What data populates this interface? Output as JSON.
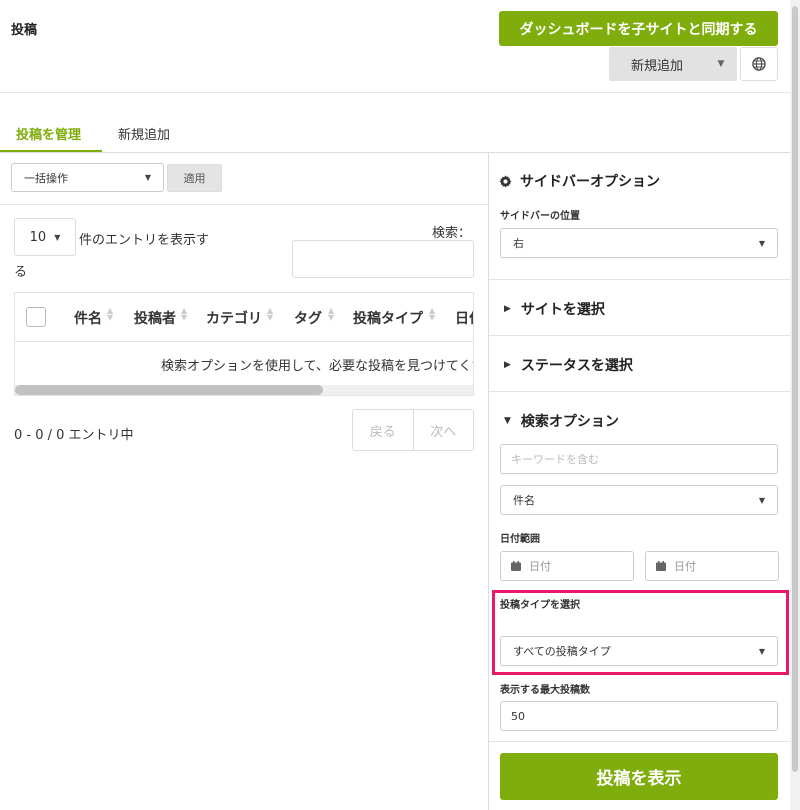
{
  "header": {
    "title": "投稿",
    "sync_button": "ダッシュボードを子サイトと同期する",
    "new_add_button": "新規追加"
  },
  "tabs": {
    "manage": "投稿を管理",
    "add_new": "新規追加"
  },
  "bulk": {
    "select_value": "一括操作",
    "apply_button": "適用"
  },
  "table_controls": {
    "length_value": "10",
    "length_text_1": "件のエントリを表示す",
    "length_text_2": "る",
    "search_label": "検索："
  },
  "table": {
    "columns": [
      "件名",
      "投稿者",
      "カテゴリ",
      "タグ",
      "投稿タイプ",
      "日付"
    ],
    "empty_message": "検索オプションを使用して、必要な投稿を見つけてください"
  },
  "footer": {
    "info": "0 - 0 / 0 エントリ中",
    "prev": "戻る",
    "next": "次へ"
  },
  "sidebar": {
    "title": "サイドバーオプション",
    "position_label": "サイドバーの位置",
    "position_value": "右",
    "select_site": "サイトを選択",
    "select_status": "ステータスを選択",
    "search_options": "検索オプション",
    "keyword_placeholder": "キーワードを含む",
    "field_value": "件名",
    "date_range_label": "日付範囲",
    "date_from_placeholder": "日付",
    "date_to_placeholder": "日付",
    "post_type_label": "投稿タイプを選択",
    "post_type_value": "すべての投稿タイプ",
    "max_posts_label": "表示する最大投稿数",
    "max_posts_value": "50",
    "show_button": "投稿を表示"
  },
  "colors": {
    "accent": "#7fad0c",
    "highlight": "#e8196a"
  },
  "icons": [
    "chevron-down-icon",
    "globe-icon",
    "gear-icon",
    "calendar-icon",
    "triangle-right-icon",
    "triangle-down-icon",
    "sort-icon"
  ]
}
